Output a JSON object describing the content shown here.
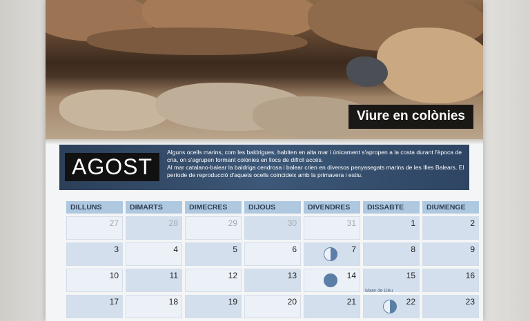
{
  "photo": {
    "title": "Viure en colònies"
  },
  "month": "AGOST",
  "description": {
    "paragraph1": "Alguns ocells marins, com les baldrigues, habiten en alta mar i únicament s'apropen a la costa durant l'època de cria, on s'agrupen formant colònies en llocs de difícil accés.",
    "paragraph2": "Al mar catalano-balear la baldriga cendrosa i balear crien en diversos penyasegats marins de les Illes Balears. El període de reproducció d'aquets ocells coincideix amb la primavera i estiu."
  },
  "weekdays": [
    "DILLUNS",
    "DIMARTS",
    "DIMECRES",
    "DIJOUS",
    "DIVENDRES",
    "DISSABTE",
    "DIUMENGE"
  ],
  "weeks": [
    [
      "27",
      "28",
      "29",
      "30",
      "31",
      "1",
      "2"
    ],
    [
      "3",
      "4",
      "5",
      "6",
      "7",
      "8",
      "9"
    ],
    [
      "10",
      "11",
      "12",
      "13",
      "14",
      "15",
      "16"
    ],
    [
      "17",
      "18",
      "19",
      "20",
      "21",
      "22",
      "23"
    ]
  ],
  "note_15": "Mare de Déu",
  "moon_phases": {
    "7": "half",
    "14": "full",
    "22": "half"
  },
  "colors": {
    "header": "#aec8e0",
    "band": "#2b3f59",
    "moon": "#5b7fa6"
  }
}
